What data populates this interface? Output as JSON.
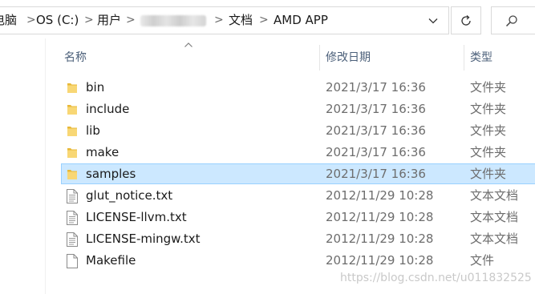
{
  "breadcrumb": {
    "items": [
      {
        "label": "电脑"
      },
      {
        "label": "OS (C:)"
      },
      {
        "label": "用户"
      },
      {
        "label": ""
      },
      {
        "label": "文档"
      },
      {
        "label": "AMD APP"
      }
    ],
    "separator": ">"
  },
  "columns": {
    "name": "名称",
    "date": "修改日期",
    "type": "类型"
  },
  "files": [
    {
      "name": "bin",
      "date": "2021/3/17 16:36",
      "type": "文件夹",
      "icon": "folder-icon",
      "selected": false
    },
    {
      "name": "include",
      "date": "2021/3/17 16:36",
      "type": "文件夹",
      "icon": "folder-icon",
      "selected": false
    },
    {
      "name": "lib",
      "date": "2021/3/17 16:36",
      "type": "文件夹",
      "icon": "folder-icon",
      "selected": false
    },
    {
      "name": "make",
      "date": "2021/3/17 16:36",
      "type": "文件夹",
      "icon": "folder-icon",
      "selected": false
    },
    {
      "name": "samples",
      "date": "2021/3/17 16:36",
      "type": "文件夹",
      "icon": "folder-icon",
      "selected": true
    },
    {
      "name": "glut_notice.txt",
      "date": "2012/11/29 10:28",
      "type": "文本文档",
      "icon": "text-file-icon",
      "selected": false
    },
    {
      "name": "LICENSE-llvm.txt",
      "date": "2012/11/29 10:28",
      "type": "文本文档",
      "icon": "text-file-icon",
      "selected": false
    },
    {
      "name": "LICENSE-mingw.txt",
      "date": "2012/11/29 10:28",
      "type": "文本文档",
      "icon": "text-file-icon",
      "selected": false
    },
    {
      "name": "Makefile",
      "date": "2012/11/29 10:28",
      "type": "文件",
      "icon": "file-icon",
      "selected": false
    }
  ],
  "watermark": "https://blog.csdn.net/u011832525",
  "colors": {
    "selection_bg": "#cce8ff",
    "selection_border": "#99d1ff",
    "folder": "#f8d775",
    "header_text": "#4c607a"
  }
}
